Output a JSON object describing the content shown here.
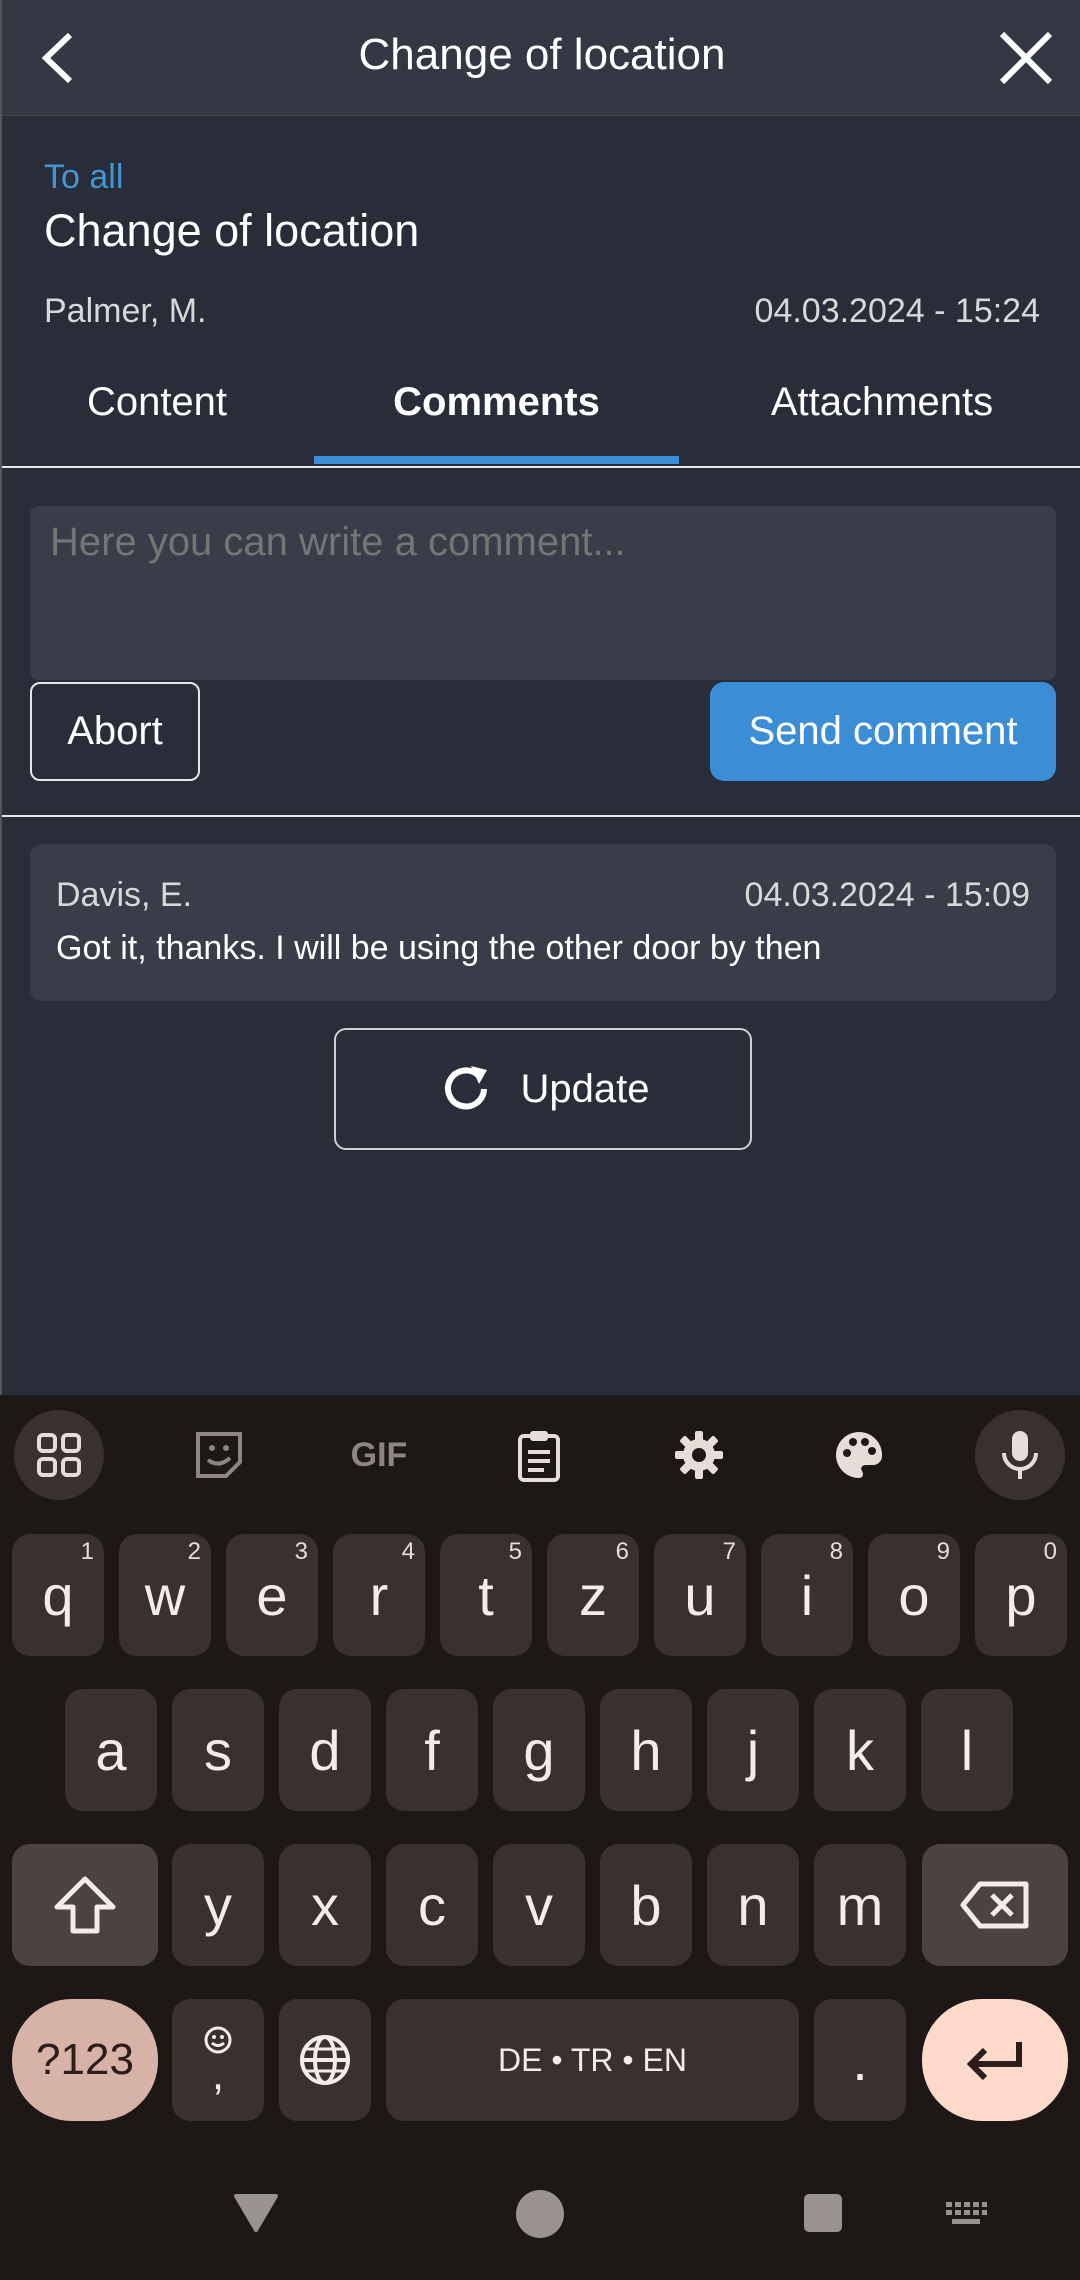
{
  "header": {
    "title": "Change of location"
  },
  "message": {
    "recipient": "To all",
    "subject": "Change of location",
    "author": "Palmer, M.",
    "date": "04.03.2024 - 15:24"
  },
  "tabs": [
    {
      "label": "Content"
    },
    {
      "label": "Comments"
    },
    {
      "label": "Attachments"
    }
  ],
  "comment_form": {
    "placeholder": "Here you can write a comment...",
    "abort_label": "Abort",
    "send_label": "Send comment"
  },
  "comments": [
    {
      "author": "Davis, E.",
      "date": "04.03.2024 - 15:09",
      "text": "Got it, thanks. I will be using the other door by then"
    }
  ],
  "update_label": "Update",
  "keyboard": {
    "toolbar_gif": "GIF",
    "row1": [
      {
        "k": "q",
        "h": "1"
      },
      {
        "k": "w",
        "h": "2"
      },
      {
        "k": "e",
        "h": "3"
      },
      {
        "k": "r",
        "h": "4"
      },
      {
        "k": "t",
        "h": "5"
      },
      {
        "k": "z",
        "h": "6"
      },
      {
        "k": "u",
        "h": "7"
      },
      {
        "k": "i",
        "h": "8"
      },
      {
        "k": "o",
        "h": "9"
      },
      {
        "k": "p",
        "h": "0"
      }
    ],
    "row2": [
      "a",
      "s",
      "d",
      "f",
      "g",
      "h",
      "j",
      "k",
      "l"
    ],
    "row3": [
      "y",
      "x",
      "c",
      "v",
      "b",
      "n",
      "m"
    ],
    "symbols_label": "?123",
    "comma_label": ",",
    "space_label": "DE • TR • EN",
    "period_label": "."
  },
  "colors": {
    "accent": "#3b8ed6",
    "background": "#292d3a",
    "keyboard_bg": "#1d1716"
  }
}
